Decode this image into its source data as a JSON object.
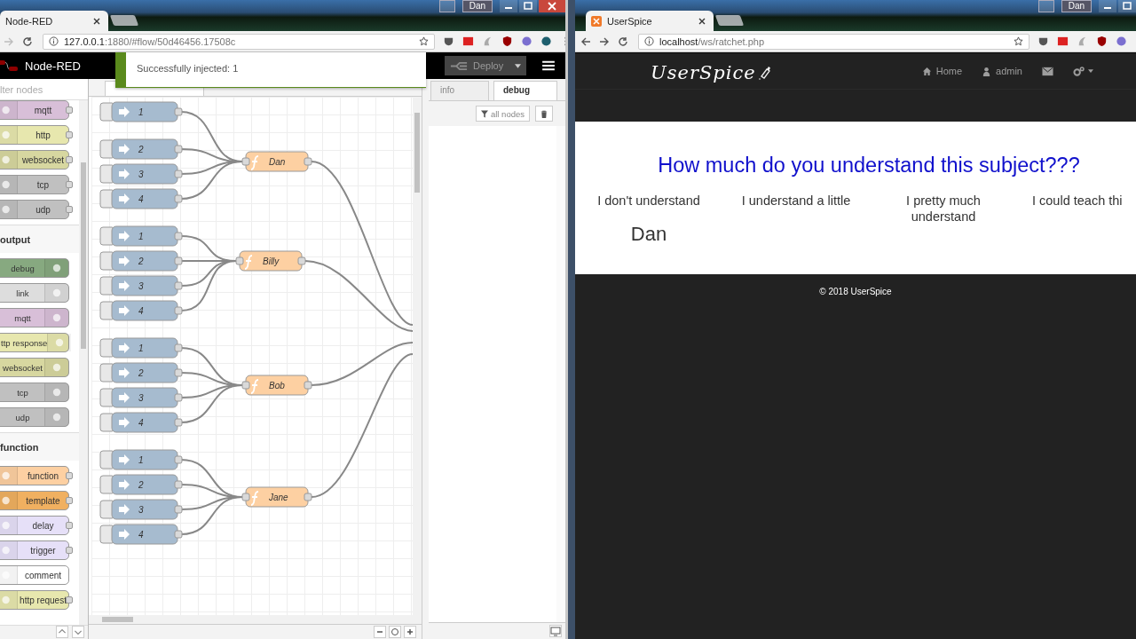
{
  "left_window": {
    "tab": "Node-RED",
    "url_host": "127.0.0.1",
    "url_path": ":1880/#flow/50d46456.17508c",
    "profile": "Dan"
  },
  "nodered": {
    "title": "Node-RED",
    "toast": "Successfully injected: 1",
    "deploy": "Deploy",
    "filter_placeholder": "lter nodes",
    "palette": [
      {
        "kind": "in",
        "label": "mqtt",
        "color": "#d8bfd8"
      },
      {
        "kind": "in",
        "label": "http",
        "color": "#e7e7ae"
      },
      {
        "kind": "in",
        "label": "websocket",
        "color": "#d7d7a0"
      },
      {
        "kind": "in",
        "label": "tcp",
        "color": "#c0c0c0"
      },
      {
        "kind": "in",
        "label": "udp",
        "color": "#c0c0c0"
      },
      {
        "kind": "category",
        "label": "output"
      },
      {
        "kind": "out",
        "label": "debug",
        "color": "#87a980"
      },
      {
        "kind": "out",
        "label": "link",
        "color": "#dddddd"
      },
      {
        "kind": "out",
        "label": "mqtt",
        "color": "#d8bfd8"
      },
      {
        "kind": "out",
        "label": "ttp response",
        "color": "#e7e7ae"
      },
      {
        "kind": "out",
        "label": "websocket",
        "color": "#d7d7a0"
      },
      {
        "kind": "out",
        "label": "tcp",
        "color": "#c0c0c0"
      },
      {
        "kind": "out",
        "label": "udp",
        "color": "#c0c0c0"
      },
      {
        "kind": "category",
        "label": "function"
      },
      {
        "kind": "in",
        "label": "function",
        "color": "#fdd0a2"
      },
      {
        "kind": "in",
        "label": "template",
        "color": "#f0b060"
      },
      {
        "kind": "in",
        "label": "delay",
        "color": "#e6e0f8"
      },
      {
        "kind": "in",
        "label": "trigger",
        "color": "#e6e0f8"
      },
      {
        "kind": "plain",
        "label": "comment",
        "color": "#ffffff"
      },
      {
        "kind": "in",
        "label": "http request",
        "color": "#e7e7ae"
      }
    ],
    "groups": [
      {
        "name": "Dan",
        "inputs": [
          "1",
          "2",
          "3",
          "4"
        ]
      },
      {
        "name": "Billy",
        "inputs": [
          "1",
          "2",
          "3",
          "4"
        ]
      },
      {
        "name": "Bob",
        "inputs": [
          "1",
          "2",
          "3",
          "4"
        ]
      },
      {
        "name": "Jane",
        "inputs": [
          "1",
          "2",
          "3",
          "4"
        ]
      }
    ],
    "sidebar_tabs": [
      {
        "label": "info",
        "selected": false
      },
      {
        "label": "debug",
        "selected": true
      }
    ],
    "debug_filter": "all nodes"
  },
  "right_window": {
    "tab": "UserSpice",
    "url_host": "localhost",
    "url_path": "/ws/ratchet.php",
    "profile": "Dan"
  },
  "userspice": {
    "logo": "UserSpice",
    "nav": [
      {
        "kind": "home",
        "label": "Home"
      },
      {
        "kind": "user",
        "label": "admin"
      },
      {
        "kind": "mail"
      },
      {
        "kind": "settings"
      }
    ],
    "question": "How much do you understand this subject???",
    "options": [
      {
        "label": "I don't understand",
        "voters": [
          "Dan"
        ]
      },
      {
        "label": "I understand a little"
      },
      {
        "label": "I pretty much understand"
      },
      {
        "label": "I could teach thi"
      }
    ],
    "footer": "© 2018 UserSpice"
  }
}
